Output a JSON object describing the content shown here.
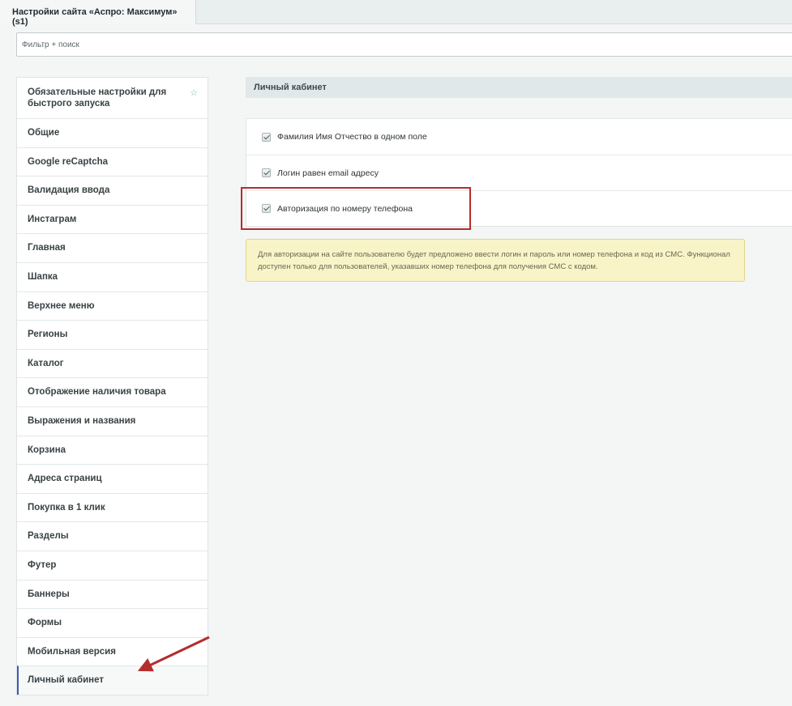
{
  "tab": {
    "title": "Настройки сайта «Аспро: Максимум» (s1)"
  },
  "filter": {
    "placeholder": "Фильтр + поиск"
  },
  "sidebar": {
    "items": [
      {
        "label": "Обязательные настройки для быстрого запуска",
        "icon": "star-icon"
      },
      {
        "label": "Общие"
      },
      {
        "label": "Google reCaptcha"
      },
      {
        "label": "Валидация ввода"
      },
      {
        "label": "Инстаграм"
      },
      {
        "label": "Главная"
      },
      {
        "label": "Шапка"
      },
      {
        "label": "Верхнее меню"
      },
      {
        "label": "Регионы"
      },
      {
        "label": "Каталог"
      },
      {
        "label": "Отображение наличия товара"
      },
      {
        "label": "Выражения и названия"
      },
      {
        "label": "Корзина"
      },
      {
        "label": "Адреса страниц"
      },
      {
        "label": "Покупка в 1 клик"
      },
      {
        "label": "Разделы"
      },
      {
        "label": "Футер"
      },
      {
        "label": "Баннеры"
      },
      {
        "label": "Формы"
      },
      {
        "label": "Мобильная версия"
      },
      {
        "label": "Личный кабинет",
        "active": true
      }
    ],
    "star_glyph": "☆"
  },
  "section": {
    "title": "Личный кабинет",
    "options": [
      {
        "label": "Фамилия Имя Отчество в одном поле",
        "checked": true
      },
      {
        "label": "Логин равен email адресу",
        "checked": true
      },
      {
        "label": "Авторизация по номеру телефона",
        "checked": true
      }
    ],
    "notice": "Для авторизации на сайте пользователю будет предложено ввести логин и пароль или номер телефона и код из СМС. Функционал доступен только для пользователей, указавших номер телефона для получения СМС с кодом."
  },
  "colors": {
    "highlight": "#b32d2d",
    "active_accent": "#3b5bb5",
    "notice_bg": "#f8f4c8"
  }
}
